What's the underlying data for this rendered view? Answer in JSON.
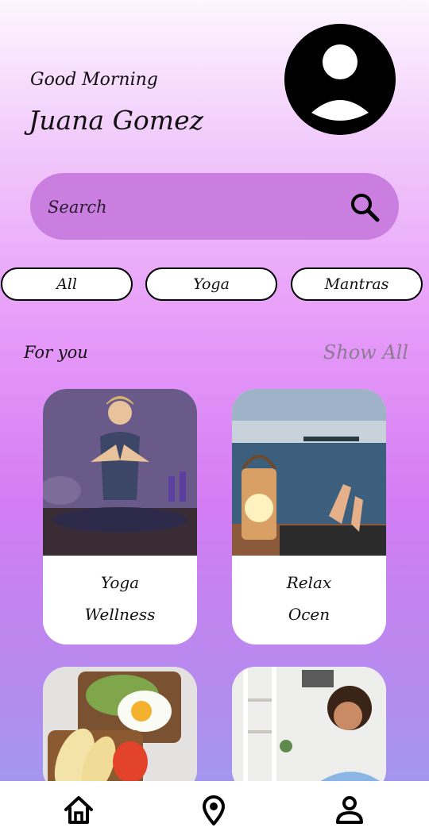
{
  "header": {
    "greeting": "Good Morning",
    "user_name": "Juana Gomez"
  },
  "avatar": {
    "icon": "user-avatar-icon"
  },
  "search": {
    "placeholder": "Search",
    "icon": "search-icon"
  },
  "filters": [
    {
      "label": "All"
    },
    {
      "label": "Yoga"
    },
    {
      "label": "Mantras"
    }
  ],
  "section": {
    "title": "For you",
    "show_all": "Show All"
  },
  "cards": [
    {
      "title": "Yoga",
      "subtitle": "Wellness"
    },
    {
      "title": "Relax",
      "subtitle": "Ocen"
    },
    {
      "title": "",
      "subtitle": ""
    },
    {
      "title": "",
      "subtitle": ""
    }
  ],
  "nav": [
    {
      "icon": "home-icon"
    },
    {
      "icon": "location-pin-icon"
    },
    {
      "icon": "profile-icon"
    }
  ],
  "colors": {
    "search_bg": "#c97ee0",
    "chip_border": "#000000",
    "show_all": "#8c7b93"
  }
}
